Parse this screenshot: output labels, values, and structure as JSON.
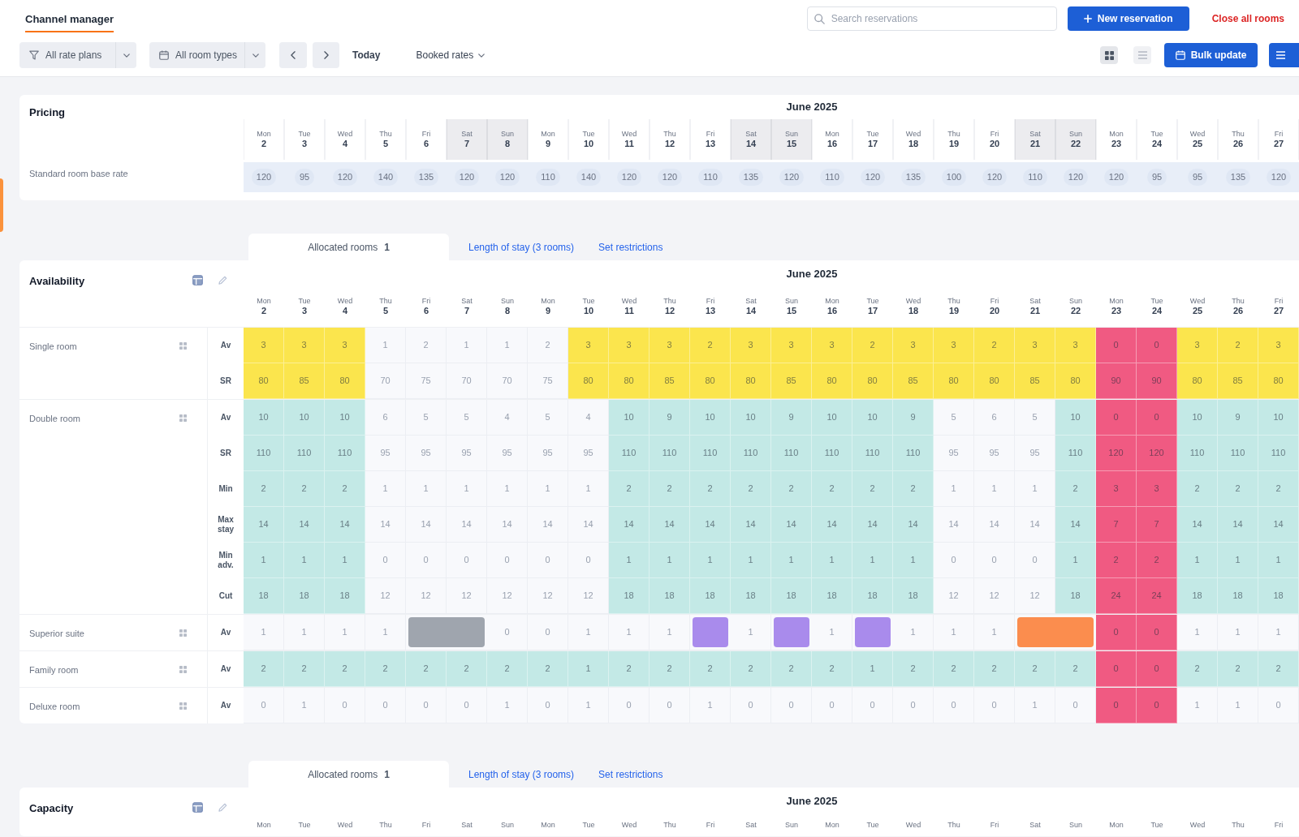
{
  "header": {
    "tabs": [
      {
        "label": "Channel manager",
        "selected": true
      }
    ],
    "search": {
      "placeholder": "Search reservations"
    },
    "new_button": "New reservation",
    "close_link": "Close all rooms"
  },
  "toolbar": {
    "filters": [
      "All rate plans",
      "All room types"
    ],
    "today": "Today",
    "rate_view": "Booked rates",
    "bulk_button": "Bulk update"
  },
  "pricing": {
    "title": "Pricing",
    "month": "June 2025",
    "days": [
      {
        "weekday": "Mon",
        "day": "2",
        "weekend": false
      },
      {
        "weekday": "Tue",
        "day": "3",
        "weekend": false
      },
      {
        "weekday": "Wed",
        "day": "4",
        "weekend": false
      },
      {
        "weekday": "Thu",
        "day": "5",
        "weekend": false
      },
      {
        "weekday": "Fri",
        "day": "6",
        "weekend": false
      },
      {
        "weekday": "Sat",
        "day": "7",
        "weekend": true
      },
      {
        "weekday": "Sun",
        "day": "8",
        "weekend": true
      },
      {
        "weekday": "Mon",
        "day": "9",
        "weekend": false
      },
      {
        "weekday": "Tue",
        "day": "10",
        "weekend": false
      },
      {
        "weekday": "Wed",
        "day": "11",
        "weekend": false
      },
      {
        "weekday": "Thu",
        "day": "12",
        "weekend": false
      },
      {
        "weekday": "Fri",
        "day": "13",
        "weekend": false
      },
      {
        "weekday": "Sat",
        "day": "14",
        "weekend": true
      },
      {
        "weekday": "Sun",
        "day": "15",
        "weekend": true
      },
      {
        "weekday": "Mon",
        "day": "16",
        "weekend": false
      },
      {
        "weekday": "Tue",
        "day": "17",
        "weekend": false
      },
      {
        "weekday": "Wed",
        "day": "18",
        "weekend": false
      },
      {
        "weekday": "Thu",
        "day": "19",
        "weekend": false
      },
      {
        "weekday": "Fri",
        "day": "20",
        "weekend": false
      },
      {
        "weekday": "Sat",
        "day": "21",
        "weekend": true
      },
      {
        "weekday": "Sun",
        "day": "22",
        "weekend": true
      },
      {
        "weekday": "Mon",
        "day": "23",
        "weekend": false
      },
      {
        "weekday": "Tue",
        "day": "24",
        "weekend": false
      },
      {
        "weekday": "Wed",
        "day": "25",
        "weekend": false
      },
      {
        "weekday": "Thu",
        "day": "26",
        "weekend": false
      },
      {
        "weekday": "Fri",
        "day": "27",
        "weekend": false
      }
    ],
    "rows": [
      {
        "label": "Standard room base rate",
        "values": [
          "120",
          "95",
          "120",
          "140",
          "135",
          "120",
          "120",
          "110",
          "140",
          "120",
          "120",
          "110",
          "135",
          "120",
          "110",
          "120",
          "135",
          "100",
          "120",
          "110",
          "120",
          "120",
          "95",
          "95",
          "135",
          "120"
        ]
      }
    ]
  },
  "sections": [
    {
      "tabs": [
        {
          "label": "Allocated rooms",
          "count": "1",
          "selected": true
        },
        {
          "label": "Length of stay (3 rooms)",
          "selected": false
        },
        {
          "label": "Set restrictions",
          "selected": false
        }
      ],
      "title": "Availability",
      "month": "June 2025",
      "days": [
        {
          "weekday": "Mon",
          "day": "2"
        },
        {
          "weekday": "Tue",
          "day": "3"
        },
        {
          "weekday": "Wed",
          "day": "4"
        },
        {
          "weekday": "Thu",
          "day": "5"
        },
        {
          "weekday": "Fri",
          "day": "6"
        },
        {
          "weekday": "Sat",
          "day": "7"
        },
        {
          "weekday": "Sun",
          "day": "8"
        },
        {
          "weekday": "Mon",
          "day": "9"
        },
        {
          "weekday": "Tue",
          "day": "10"
        },
        {
          "weekday": "Wed",
          "day": "11"
        },
        {
          "weekday": "Thu",
          "day": "12"
        },
        {
          "weekday": "Fri",
          "day": "13"
        },
        {
          "weekday": "Sat",
          "day": "14"
        },
        {
          "weekday": "Sun",
          "day": "15"
        },
        {
          "weekday": "Mon",
          "day": "16"
        },
        {
          "weekday": "Tue",
          "day": "17"
        },
        {
          "weekday": "Wed",
          "day": "18"
        },
        {
          "weekday": "Thu",
          "day": "19"
        },
        {
          "weekday": "Fri",
          "day": "20"
        },
        {
          "weekday": "Sat",
          "day": "21"
        },
        {
          "weekday": "Sun",
          "day": "22"
        },
        {
          "weekday": "Mon",
          "day": "23"
        },
        {
          "weekday": "Tue",
          "day": "24"
        },
        {
          "weekday": "Wed",
          "day": "25"
        },
        {
          "weekday": "Thu",
          "day": "26"
        },
        {
          "weekday": "Fri",
          "day": "27"
        }
      ],
      "groups": [
        {
          "label": "Single room",
          "rows": [
            {
              "label": "Av",
              "cells": [
                {
                  "value": "3",
                  "color": "#fbe54d"
                },
                {
                  "value": "3",
                  "color": "#fbe54d"
                },
                {
                  "value": "3",
                  "color": "#fbe54d"
                },
                {
                  "value": "1"
                },
                {
                  "value": "2"
                },
                {
                  "value": "1"
                },
                {
                  "value": "1"
                },
                {
                  "value": "2"
                },
                {
                  "value": "3",
                  "color": "#fbe54d"
                },
                {
                  "value": "3",
                  "color": "#fbe54d"
                },
                {
                  "value": "3",
                  "color": "#fbe54d"
                },
                {
                  "value": "2",
                  "color": "#fbe54d"
                },
                {
                  "value": "3",
                  "color": "#fbe54d"
                },
                {
                  "value": "3",
                  "color": "#fbe54d"
                },
                {
                  "value": "3",
                  "color": "#fbe54d"
                },
                {
                  "value": "2",
                  "color": "#fbe54d"
                },
                {
                  "value": "3",
                  "color": "#fbe54d"
                },
                {
                  "value": "3",
                  "color": "#fbe54d"
                },
                {
                  "value": "2",
                  "color": "#fbe54d"
                },
                {
                  "value": "3",
                  "color": "#fbe54d"
                },
                {
                  "value": "3",
                  "color": "#fbe54d"
                },
                {
                  "value": "0",
                  "color": "#f05a82"
                },
                {
                  "value": "0",
                  "color": "#f05a82"
                },
                {
                  "value": "3",
                  "color": "#fbe54d"
                },
                {
                  "value": "2",
                  "color": "#fbe54d"
                },
                {
                  "value": "3",
                  "color": "#fbe54d"
                }
              ]
            },
            {
              "label": "SR",
              "cells": [
                {
                  "value": "80",
                  "color": "#fbe54d"
                },
                {
                  "value": "85",
                  "color": "#fbe54d"
                },
                {
                  "value": "80",
                  "color": "#fbe54d"
                },
                {
                  "value": "70"
                },
                {
                  "value": "75"
                },
                {
                  "value": "70"
                },
                {
                  "value": "70"
                },
                {
                  "value": "75"
                },
                {
                  "value": "80",
                  "color": "#fbe54d"
                },
                {
                  "value": "80",
                  "color": "#fbe54d"
                },
                {
                  "value": "85",
                  "color": "#fbe54d"
                },
                {
                  "value": "80",
                  "color": "#fbe54d"
                },
                {
                  "value": "80",
                  "color": "#fbe54d"
                },
                {
                  "value": "85",
                  "color": "#fbe54d"
                },
                {
                  "value": "80",
                  "color": "#fbe54d"
                },
                {
                  "value": "80",
                  "color": "#fbe54d"
                },
                {
                  "value": "85",
                  "color": "#fbe54d"
                },
                {
                  "value": "80",
                  "color": "#fbe54d"
                },
                {
                  "value": "80",
                  "color": "#fbe54d"
                },
                {
                  "value": "85",
                  "color": "#fbe54d"
                },
                {
                  "value": "80",
                  "color": "#fbe54d"
                },
                {
                  "value": "90",
                  "color": "#f05a82"
                },
                {
                  "value": "90",
                  "color": "#f05a82"
                },
                {
                  "value": "80",
                  "color": "#fbe54d"
                },
                {
                  "value": "85",
                  "color": "#fbe54d"
                },
                {
                  "value": "80",
                  "color": "#fbe54d"
                }
              ]
            }
          ]
        },
        {
          "label": "Double room",
          "rows": [
            {
              "label": "Av",
              "cells": [
                {
                  "value": "10",
                  "color": "#c3e9e6"
                },
                {
                  "value": "10",
                  "color": "#c3e9e6"
                },
                {
                  "value": "10",
                  "color": "#c3e9e6"
                },
                {
                  "value": "6"
                },
                {
                  "value": "5"
                },
                {
                  "value": "5"
                },
                {
                  "value": "4"
                },
                {
                  "value": "5"
                },
                {
                  "value": "4"
                },
                {
                  "value": "10",
                  "color": "#c3e9e6"
                },
                {
                  "value": "9",
                  "color": "#c3e9e6"
                },
                {
                  "value": "10",
                  "color": "#c3e9e6"
                },
                {
                  "value": "10",
                  "color": "#c3e9e6"
                },
                {
                  "value": "9",
                  "color": "#c3e9e6"
                },
                {
                  "value": "10",
                  "color": "#c3e9e6"
                },
                {
                  "value": "10",
                  "color": "#c3e9e6"
                },
                {
                  "value": "9",
                  "color": "#c3e9e6"
                },
                {
                  "value": "5"
                },
                {
                  "value": "6"
                },
                {
                  "value": "5"
                },
                {
                  "value": "10",
                  "color": "#c3e9e6"
                },
                {
                  "value": "0",
                  "color": "#f05a82"
                },
                {
                  "value": "0",
                  "color": "#f05a82"
                },
                {
                  "value": "10",
                  "color": "#c3e9e6"
                },
                {
                  "value": "9",
                  "color": "#c3e9e6"
                },
                {
                  "value": "10",
                  "color": "#c3e9e6"
                }
              ]
            },
            {
              "label": "SR",
              "cells": [
                {
                  "value": "110",
                  "color": "#c3e9e6"
                },
                {
                  "value": "110",
                  "color": "#c3e9e6"
                },
                {
                  "value": "110",
                  "color": "#c3e9e6"
                },
                {
                  "value": "95"
                },
                {
                  "value": "95"
                },
                {
                  "value": "95"
                },
                {
                  "value": "95"
                },
                {
                  "value": "95"
                },
                {
                  "value": "95"
                },
                {
                  "value": "110",
                  "color": "#c3e9e6"
                },
                {
                  "value": "110",
                  "color": "#c3e9e6"
                },
                {
                  "value": "110",
                  "color": "#c3e9e6"
                },
                {
                  "value": "110",
                  "color": "#c3e9e6"
                },
                {
                  "value": "110",
                  "color": "#c3e9e6"
                },
                {
                  "value": "110",
                  "color": "#c3e9e6"
                },
                {
                  "value": "110",
                  "color": "#c3e9e6"
                },
                {
                  "value": "110",
                  "color": "#c3e9e6"
                },
                {
                  "value": "95"
                },
                {
                  "value": "95"
                },
                {
                  "value": "95"
                },
                {
                  "value": "110",
                  "color": "#c3e9e6"
                },
                {
                  "value": "120",
                  "color": "#f05a82"
                },
                {
                  "value": "120",
                  "color": "#f05a82"
                },
                {
                  "value": "110",
                  "color": "#c3e9e6"
                },
                {
                  "value": "110",
                  "color": "#c3e9e6"
                },
                {
                  "value": "110",
                  "color": "#c3e9e6"
                }
              ]
            },
            {
              "label": "Min",
              "cells": [
                {
                  "value": "2",
                  "color": "#c3e9e6"
                },
                {
                  "value": "2",
                  "color": "#c3e9e6"
                },
                {
                  "value": "2",
                  "color": "#c3e9e6"
                },
                {
                  "value": "1"
                },
                {
                  "value": "1"
                },
                {
                  "value": "1"
                },
                {
                  "value": "1"
                },
                {
                  "value": "1"
                },
                {
                  "value": "1"
                },
                {
                  "value": "2",
                  "color": "#c3e9e6"
                },
                {
                  "value": "2",
                  "color": "#c3e9e6"
                },
                {
                  "value": "2",
                  "color": "#c3e9e6"
                },
                {
                  "value": "2",
                  "color": "#c3e9e6"
                },
                {
                  "value": "2",
                  "color": "#c3e9e6"
                },
                {
                  "value": "2",
                  "color": "#c3e9e6"
                },
                {
                  "value": "2",
                  "color": "#c3e9e6"
                },
                {
                  "value": "2",
                  "color": "#c3e9e6"
                },
                {
                  "value": "1"
                },
                {
                  "value": "1"
                },
                {
                  "value": "1"
                },
                {
                  "value": "2",
                  "color": "#c3e9e6"
                },
                {
                  "value": "3",
                  "color": "#f05a82"
                },
                {
                  "value": "3",
                  "color": "#f05a82"
                },
                {
                  "value": "2",
                  "color": "#c3e9e6"
                },
                {
                  "value": "2",
                  "color": "#c3e9e6"
                },
                {
                  "value": "2",
                  "color": "#c3e9e6"
                }
              ]
            },
            {
              "label": "Max stay",
              "cells": [
                {
                  "value": "14",
                  "color": "#c3e9e6"
                },
                {
                  "value": "14",
                  "color": "#c3e9e6"
                },
                {
                  "value": "14",
                  "color": "#c3e9e6"
                },
                {
                  "value": "14"
                },
                {
                  "value": "14"
                },
                {
                  "value": "14"
                },
                {
                  "value": "14"
                },
                {
                  "value": "14"
                },
                {
                  "value": "14"
                },
                {
                  "value": "14",
                  "color": "#c3e9e6"
                },
                {
                  "value": "14",
                  "color": "#c3e9e6"
                },
                {
                  "value": "14",
                  "color": "#c3e9e6"
                },
                {
                  "value": "14",
                  "color": "#c3e9e6"
                },
                {
                  "value": "14",
                  "color": "#c3e9e6"
                },
                {
                  "value": "14",
                  "color": "#c3e9e6"
                },
                {
                  "value": "14",
                  "color": "#c3e9e6"
                },
                {
                  "value": "14",
                  "color": "#c3e9e6"
                },
                {
                  "value": "14"
                },
                {
                  "value": "14"
                },
                {
                  "value": "14"
                },
                {
                  "value": "14",
                  "color": "#c3e9e6"
                },
                {
                  "value": "7",
                  "color": "#f05a82"
                },
                {
                  "value": "7",
                  "color": "#f05a82"
                },
                {
                  "value": "14",
                  "color": "#c3e9e6"
                },
                {
                  "value": "14",
                  "color": "#c3e9e6"
                },
                {
                  "value": "14",
                  "color": "#c3e9e6"
                }
              ]
            },
            {
              "label": "Min adv.",
              "cells": [
                {
                  "value": "1",
                  "color": "#c3e9e6"
                },
                {
                  "value": "1",
                  "color": "#c3e9e6"
                },
                {
                  "value": "1",
                  "color": "#c3e9e6"
                },
                {
                  "value": "0"
                },
                {
                  "value": "0"
                },
                {
                  "value": "0"
                },
                {
                  "value": "0"
                },
                {
                  "value": "0"
                },
                {
                  "value": "0"
                },
                {
                  "value": "1",
                  "color": "#c3e9e6"
                },
                {
                  "value": "1",
                  "color": "#c3e9e6"
                },
                {
                  "value": "1",
                  "color": "#c3e9e6"
                },
                {
                  "value": "1",
                  "color": "#c3e9e6"
                },
                {
                  "value": "1",
                  "color": "#c3e9e6"
                },
                {
                  "value": "1",
                  "color": "#c3e9e6"
                },
                {
                  "value": "1",
                  "color": "#c3e9e6"
                },
                {
                  "value": "1",
                  "color": "#c3e9e6"
                },
                {
                  "value": "0"
                },
                {
                  "value": "0"
                },
                {
                  "value": "0"
                },
                {
                  "value": "1",
                  "color": "#c3e9e6"
                },
                {
                  "value": "2",
                  "color": "#f05a82"
                },
                {
                  "value": "2",
                  "color": "#f05a82"
                },
                {
                  "value": "1",
                  "color": "#c3e9e6"
                },
                {
                  "value": "1",
                  "color": "#c3e9e6"
                },
                {
                  "value": "1",
                  "color": "#c3e9e6"
                }
              ]
            },
            {
              "label": "Cut",
              "cells": [
                {
                  "value": "18",
                  "color": "#c3e9e6"
                },
                {
                  "value": "18",
                  "color": "#c3e9e6"
                },
                {
                  "value": "18",
                  "color": "#c3e9e6"
                },
                {
                  "value": "12"
                },
                {
                  "value": "12"
                },
                {
                  "value": "12"
                },
                {
                  "value": "12"
                },
                {
                  "value": "12"
                },
                {
                  "value": "12"
                },
                {
                  "value": "18",
                  "color": "#c3e9e6"
                },
                {
                  "value": "18",
                  "color": "#c3e9e6"
                },
                {
                  "value": "18",
                  "color": "#c3e9e6"
                },
                {
                  "value": "18",
                  "color": "#c3e9e6"
                },
                {
                  "value": "18",
                  "color": "#c3e9e6"
                },
                {
                  "value": "18",
                  "color": "#c3e9e6"
                },
                {
                  "value": "18",
                  "color": "#c3e9e6"
                },
                {
                  "value": "18",
                  "color": "#c3e9e6"
                },
                {
                  "value": "12"
                },
                {
                  "value": "12"
                },
                {
                  "value": "12"
                },
                {
                  "value": "18",
                  "color": "#c3e9e6"
                },
                {
                  "value": "24",
                  "color": "#f05a82"
                },
                {
                  "value": "24",
                  "color": "#f05a82"
                },
                {
                  "value": "18",
                  "color": "#c3e9e6"
                },
                {
                  "value": "18",
                  "color": "#c3e9e6"
                },
                {
                  "value": "18",
                  "color": "#c3e9e6"
                }
              ]
            }
          ]
        },
        {
          "label": "Superior suite",
          "rows": [
            {
              "label": "Av",
              "cells": [
                {
                  "value": "1"
                },
                {
                  "value": "1"
                },
                {
                  "value": "1"
                },
                {
                  "value": "1"
                },
                {
                  "color": "#9fa5ae",
                  "booking": true
                },
                {
                  "color": "#9fa5ae",
                  "booking": true
                },
                {
                  "value": "0"
                },
                {
                  "value": "0"
                },
                {
                  "value": "1"
                },
                {
                  "value": "1"
                },
                {
                  "value": "1"
                },
                {
                  "color": "#a98bec",
                  "booking": true
                },
                {
                  "value": "1"
                },
                {
                  "color": "#a98bec",
                  "booking": true
                },
                {
                  "value": "1"
                },
                {
                  "color": "#a98bec",
                  "booking": true
                },
                {
                  "value": "1"
                },
                {
                  "value": "1"
                },
                {
                  "value": "1"
                },
                {
                  "color": "#fb8d4e",
                  "booking": true
                },
                {
                  "color": "#fb8d4e",
                  "booking": true
                },
                {
                  "value": "0",
                  "color": "#f05a82"
                },
                {
                  "value": "0",
                  "color": "#f05a82"
                },
                {
                  "value": "1"
                },
                {
                  "value": "1"
                },
                {
                  "value": "1"
                }
              ]
            }
          ]
        },
        {
          "label": "Family room",
          "rows": [
            {
              "label": "Av",
              "cells": [
                {
                  "value": "2",
                  "color": "#c3e9e6"
                },
                {
                  "value": "2",
                  "color": "#c3e9e6"
                },
                {
                  "value": "2",
                  "color": "#c3e9e6"
                },
                {
                  "value": "2",
                  "color": "#c3e9e6"
                },
                {
                  "value": "2",
                  "color": "#c3e9e6"
                },
                {
                  "value": "2",
                  "color": "#c3e9e6"
                },
                {
                  "value": "2",
                  "color": "#c3e9e6"
                },
                {
                  "value": "2",
                  "color": "#c3e9e6"
                },
                {
                  "value": "1",
                  "color": "#c3e9e6"
                },
                {
                  "value": "2",
                  "color": "#c3e9e6"
                },
                {
                  "value": "2",
                  "color": "#c3e9e6"
                },
                {
                  "value": "2",
                  "color": "#c3e9e6"
                },
                {
                  "value": "2",
                  "color": "#c3e9e6"
                },
                {
                  "value": "2",
                  "color": "#c3e9e6"
                },
                {
                  "value": "2",
                  "color": "#c3e9e6"
                },
                {
                  "value": "1",
                  "color": "#c3e9e6"
                },
                {
                  "value": "2",
                  "color": "#c3e9e6"
                },
                {
                  "value": "2",
                  "color": "#c3e9e6"
                },
                {
                  "value": "2",
                  "color": "#c3e9e6"
                },
                {
                  "value": "2",
                  "color": "#c3e9e6"
                },
                {
                  "value": "2",
                  "color": "#c3e9e6"
                },
                {
                  "value": "0",
                  "color": "#f05a82"
                },
                {
                  "value": "0",
                  "color": "#f05a82"
                },
                {
                  "value": "2",
                  "color": "#c3e9e6"
                },
                {
                  "value": "2",
                  "color": "#c3e9e6"
                },
                {
                  "value": "2",
                  "color": "#c3e9e6"
                }
              ]
            }
          ]
        },
        {
          "label": "Deluxe room",
          "rows": [
            {
              "label": "Av",
              "cells": [
                {
                  "value": "0"
                },
                {
                  "value": "1"
                },
                {
                  "value": "0"
                },
                {
                  "value": "0"
                },
                {
                  "value": "0"
                },
                {
                  "value": "0"
                },
                {
                  "value": "1"
                },
                {
                  "value": "0"
                },
                {
                  "value": "1"
                },
                {
                  "value": "0"
                },
                {
                  "value": "0"
                },
                {
                  "value": "1"
                },
                {
                  "value": "0"
                },
                {
                  "value": "0"
                },
                {
                  "value": "0"
                },
                {
                  "value": "0"
                },
                {
                  "value": "0"
                },
                {
                  "value": "0"
                },
                {
                  "value": "0"
                },
                {
                  "value": "1"
                },
                {
                  "value": "0"
                },
                {
                  "value": "0",
                  "color": "#f05a82"
                },
                {
                  "value": "0",
                  "color": "#f05a82"
                },
                {
                  "value": "1"
                },
                {
                  "value": "1"
                },
                {
                  "value": "0"
                }
              ]
            }
          ]
        }
      ]
    },
    {
      "tabs": [
        {
          "label": "Allocated rooms",
          "count": "1",
          "selected": true
        },
        {
          "label": "Length of stay (3 rooms)",
          "selected": false
        },
        {
          "label": "Set restrictions",
          "selected": false
        }
      ],
      "title": "Capacity",
      "month": "June 2025",
      "days": [
        {
          "weekday": "Mon"
        },
        {
          "weekday": "Tue"
        },
        {
          "weekday": "Wed"
        },
        {
          "weekday": "Thu"
        },
        {
          "weekday": "Fri"
        },
        {
          "weekday": "Sat"
        },
        {
          "weekday": "Sun"
        },
        {
          "weekday": "Mon"
        },
        {
          "weekday": "Tue"
        },
        {
          "weekday": "Wed"
        },
        {
          "weekday": "Thu"
        },
        {
          "weekday": "Fri"
        },
        {
          "weekday": "Sat"
        },
        {
          "weekday": "Sun"
        },
        {
          "weekday": "Mon"
        },
        {
          "weekday": "Tue"
        },
        {
          "weekday": "Wed"
        },
        {
          "weekday": "Thu"
        },
        {
          "weekday": "Fri"
        },
        {
          "weekday": "Sat"
        },
        {
          "weekday": "Sun"
        },
        {
          "weekday": "Mon"
        },
        {
          "weekday": "Tue"
        },
        {
          "weekday": "Wed"
        },
        {
          "weekday": "Thu"
        },
        {
          "weekday": "Fri"
        }
      ]
    }
  ]
}
